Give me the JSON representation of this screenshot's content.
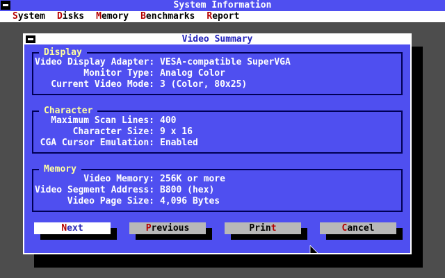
{
  "app": {
    "title": "System Information"
  },
  "menu": {
    "items": [
      {
        "label": "System",
        "accel_index": 0
      },
      {
        "label": "Disks",
        "accel_index": 0
      },
      {
        "label": "Memory",
        "accel_index": 0
      },
      {
        "label": "Benchmarks",
        "accel_index": 0
      },
      {
        "label": "Report",
        "accel_index": 0
      }
    ]
  },
  "dialog": {
    "title": "Video Summary",
    "groups": [
      {
        "name": "Display",
        "rows": [
          {
            "label": "Video Display Adapter:",
            "value": "VESA-compatible SuperVGA"
          },
          {
            "label": "Monitor Type:",
            "value": "Analog Color"
          },
          {
            "label": "Current Video Mode:",
            "value": "3 (Color, 80x25)"
          }
        ]
      },
      {
        "name": "Character",
        "rows": [
          {
            "label": "Maximum Scan Lines:",
            "value": "400"
          },
          {
            "label": "Character Size:",
            "value": "9 x 16"
          },
          {
            "label": "CGA Cursor Emulation:",
            "value": "Enabled"
          }
        ]
      },
      {
        "name": "Memory",
        "rows": [
          {
            "label": "Video Memory:",
            "value": "256K or more"
          },
          {
            "label": "Video Segment Address:",
            "value": "B800 (hex)"
          },
          {
            "label": "Video Page Size:",
            "value": "4,096 Bytes"
          }
        ]
      }
    ],
    "buttons": [
      {
        "label": "Next",
        "accel_index": 0,
        "variant": "primary"
      },
      {
        "label": "Previous",
        "accel_index": 0,
        "variant": "default"
      },
      {
        "label": "Print",
        "accel_index": 4,
        "variant": "default"
      },
      {
        "label": "Cancel",
        "accel_index": 0,
        "variant": "default"
      }
    ]
  },
  "colors": {
    "titlebar_blue": "#4f4ff0",
    "dialog_blue": "#4f4ff0",
    "desktop_gray": "#4d4d4d",
    "group_border_navy": "#000055",
    "group_title_yellow": "#ffffa0",
    "accel_red": "#b40000",
    "button_gray": "#b8b8b8",
    "button_primary_text": "#2828b4",
    "shadow_black": "#000000"
  },
  "icons": {
    "system_menu": "minus-icon",
    "cursor": "arrow-pointer-icon"
  }
}
